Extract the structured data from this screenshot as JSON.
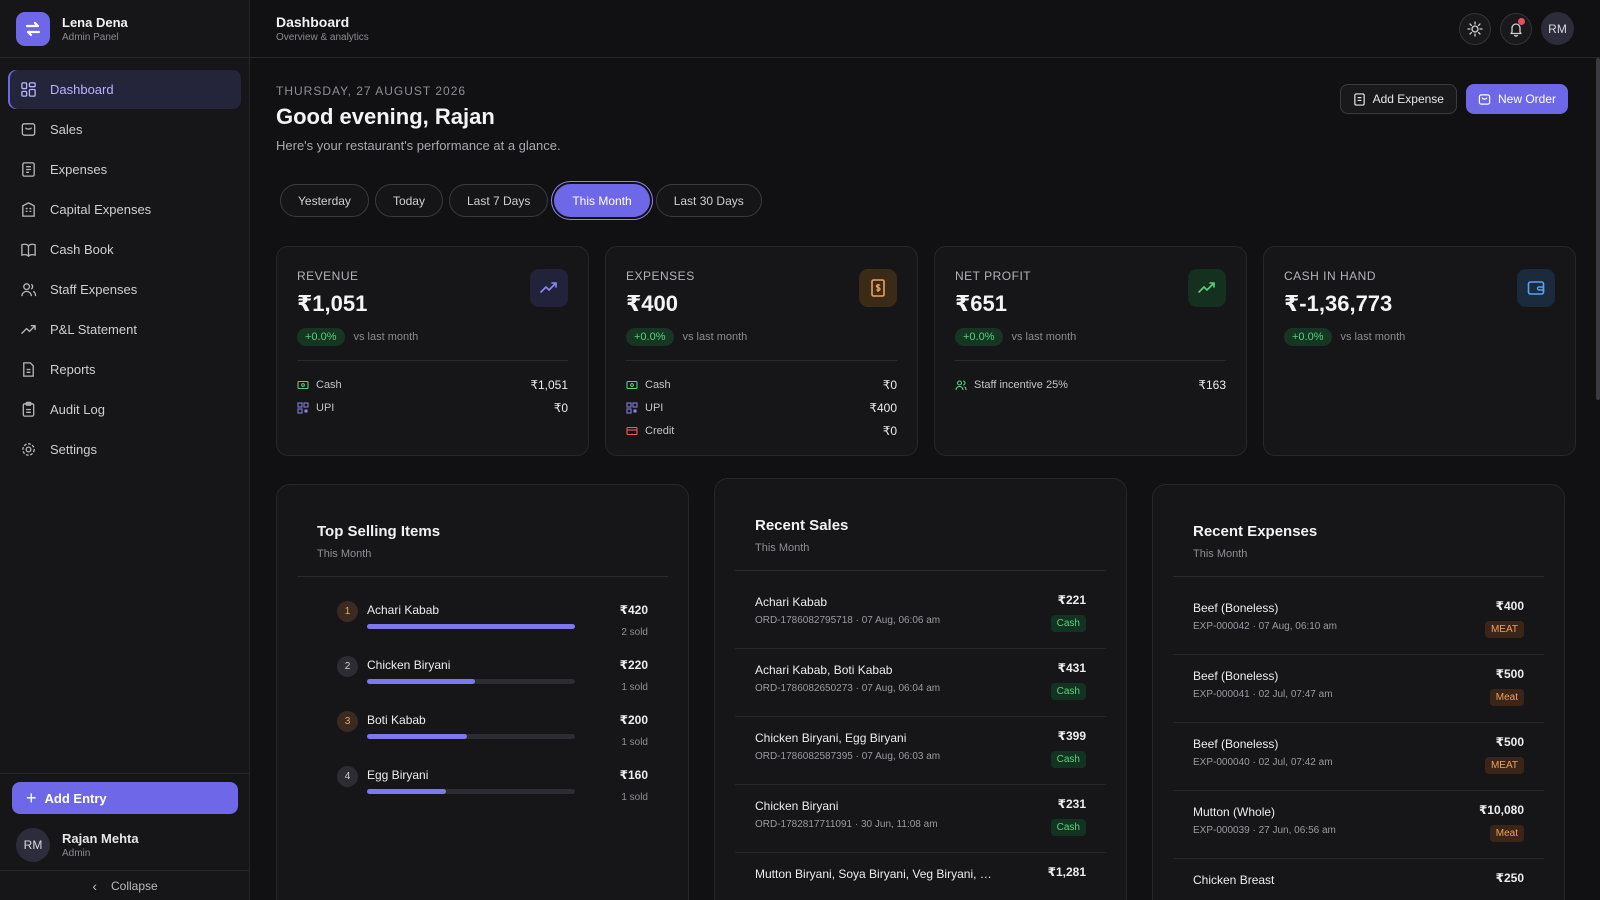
{
  "brand": {
    "name": "Lena Dena",
    "subtitle": "Admin Panel"
  },
  "nav": [
    {
      "label": "Dashboard",
      "icon": "dashboard-icon"
    },
    {
      "label": "Sales",
      "icon": "sales-icon"
    },
    {
      "label": "Expenses",
      "icon": "expenses-icon"
    },
    {
      "label": "Capital Expenses",
      "icon": "capital-icon"
    },
    {
      "label": "Cash Book",
      "icon": "book-icon"
    },
    {
      "label": "Staff Expenses",
      "icon": "staff-icon"
    },
    {
      "label": "P&L Statement",
      "icon": "trend-icon"
    },
    {
      "label": "Reports",
      "icon": "reports-icon"
    },
    {
      "label": "Audit Log",
      "icon": "audit-icon"
    },
    {
      "label": "Settings",
      "icon": "gear-icon"
    }
  ],
  "sidebar_bottom": {
    "add_entry": "Add Entry",
    "user_initials": "RM",
    "user_name": "Rajan Mehta",
    "user_role": "Admin",
    "collapse": "Collapse"
  },
  "header": {
    "title": "Dashboard",
    "subtitle": "Overview & analytics",
    "avatar": "RM"
  },
  "greeting": {
    "date": "THURSDAY, 27 AUGUST 2026",
    "hello": "Good evening, Rajan",
    "tagline": "Here's your restaurant's performance at a glance."
  },
  "actions": {
    "add_expense": "Add Expense",
    "new_order": "New Order"
  },
  "filters": [
    "Yesterday",
    "Today",
    "Last 7 Days",
    "This Month",
    "Last 30 Days"
  ],
  "stats": {
    "revenue": {
      "label": "REVENUE",
      "value": "₹1,051",
      "change": "+0.0%",
      "vs": "vs last month",
      "rows": [
        {
          "label": "Cash",
          "value": "₹1,051"
        },
        {
          "label": "UPI",
          "value": "₹0"
        }
      ]
    },
    "expenses": {
      "label": "EXPENSES",
      "value": "₹400",
      "change": "+0.0%",
      "vs": "vs last month",
      "rows": [
        {
          "label": "Cash",
          "value": "₹0"
        },
        {
          "label": "UPI",
          "value": "₹400"
        },
        {
          "label": "Credit",
          "value": "₹0"
        }
      ]
    },
    "profit": {
      "label": "NET PROFIT",
      "value": "₹651",
      "change": "+0.0%",
      "vs": "vs last month",
      "rows": [
        {
          "label": "Staff incentive 25%",
          "value": "₹163"
        }
      ]
    },
    "cash": {
      "label": "CASH IN HAND",
      "value": "₹-1,36,773",
      "change": "+0.0%",
      "vs": "vs last month"
    }
  },
  "top_selling": {
    "title": "Top Selling Items",
    "subtitle": "This Month",
    "items": [
      {
        "rank": "1",
        "name": "Achari Kabab",
        "amount": "₹420",
        "sold": "2 sold",
        "share": 1.0
      },
      {
        "rank": "2",
        "name": "Chicken Biryani",
        "amount": "₹220",
        "sold": "1 sold",
        "share": 0.52
      },
      {
        "rank": "3",
        "name": "Boti Kabab",
        "amount": "₹200",
        "sold": "1 sold",
        "share": 0.48
      },
      {
        "rank": "4",
        "name": "Egg Biryani",
        "amount": "₹160",
        "sold": "1 sold",
        "share": 0.38
      }
    ]
  },
  "recent_sales": {
    "title": "Recent Sales",
    "subtitle": "This Month",
    "items": [
      {
        "name": "Achari Kabab",
        "meta": "ORD-1786082795718 · 07 Aug, 06:06 am",
        "amount": "₹221",
        "tag": "Cash"
      },
      {
        "name": "Achari Kabab, Boti Kabab",
        "meta": "ORD-1786082650273 · 07 Aug, 06:04 am",
        "amount": "₹431",
        "tag": "Cash"
      },
      {
        "name": "Chicken Biryani, Egg Biryani",
        "meta": "ORD-1786082587395 · 07 Aug, 06:03 am",
        "amount": "₹399",
        "tag": "Cash"
      },
      {
        "name": "Chicken Biryani",
        "meta": "ORD-1782817711091 · 30 Jun, 11:08 am",
        "amount": "₹231",
        "tag": "Cash"
      },
      {
        "name": "Mutton Biryani, Soya Biryani, Veg Biryani, P...",
        "meta": "",
        "amount": "₹1,281",
        "tag": ""
      }
    ]
  },
  "recent_expenses": {
    "title": "Recent Expenses",
    "subtitle": "This Month",
    "items": [
      {
        "name": "Beef (Boneless)",
        "meta": "EXP-000042 · 07 Aug, 06:10 am",
        "amount": "₹400",
        "tag": "MEAT"
      },
      {
        "name": "Beef (Boneless)",
        "meta": "EXP-000041 · 02 Jul, 07:47 am",
        "amount": "₹500",
        "tag": "Meat"
      },
      {
        "name": "Beef (Boneless)",
        "meta": "EXP-000040 · 02 Jul, 07:42 am",
        "amount": "₹500",
        "tag": "MEAT"
      },
      {
        "name": "Mutton (Whole)",
        "meta": "EXP-000039 · 27 Jun, 06:56 am",
        "amount": "₹10,080",
        "tag": "Meat"
      },
      {
        "name": "Chicken Breast",
        "meta": "",
        "amount": "₹250",
        "tag": ""
      }
    ]
  },
  "colors": {
    "accent": "#6e68e8",
    "background": "#111113",
    "positive": "#57d27c",
    "meat": "#f0a05a"
  }
}
